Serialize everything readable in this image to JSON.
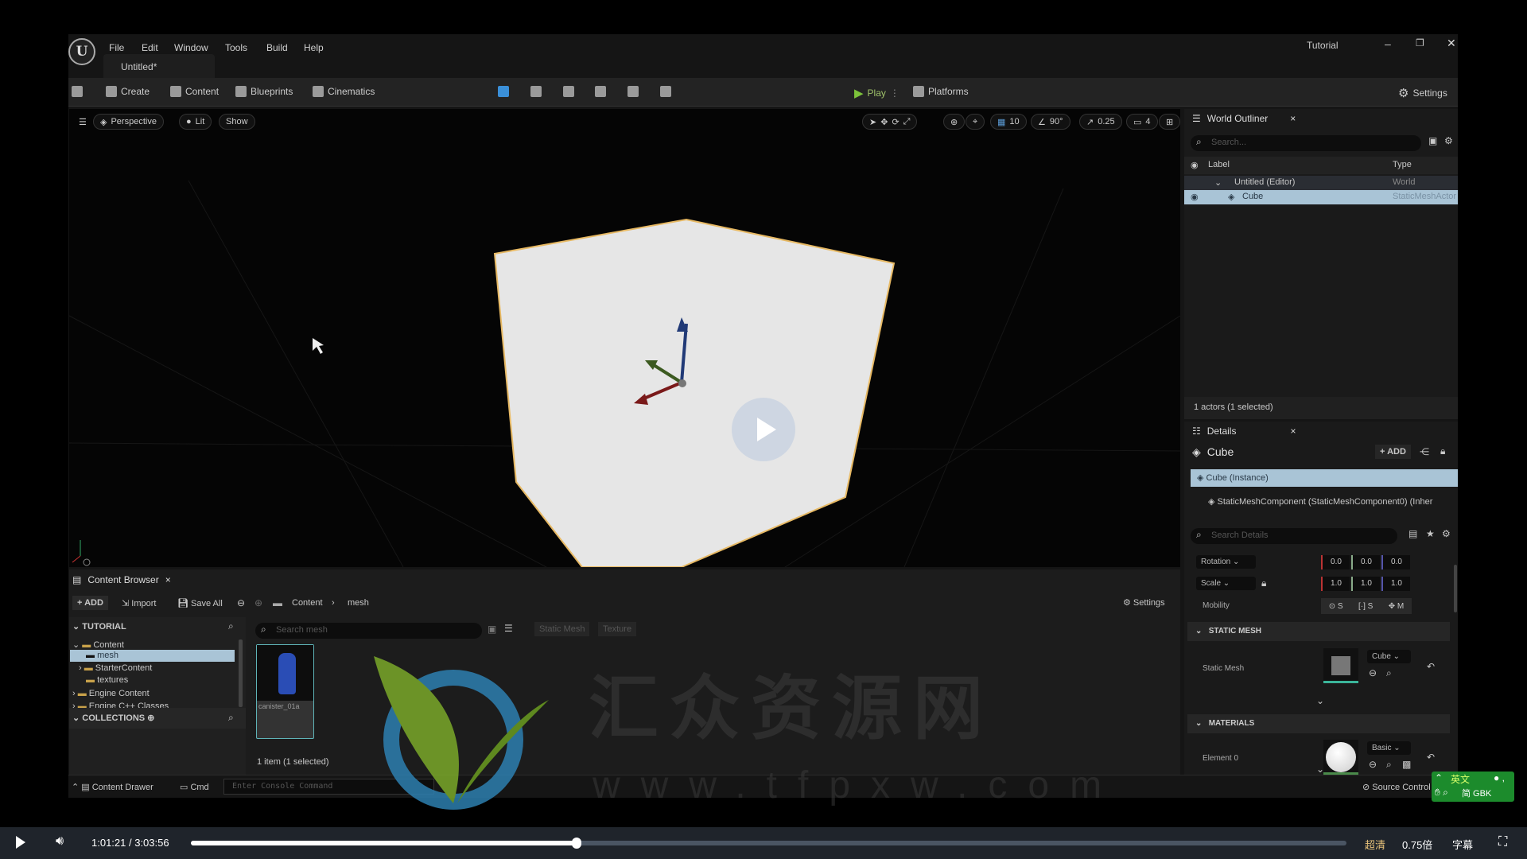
{
  "menu": {
    "items": [
      "File",
      "Edit",
      "Window",
      "Tools",
      "Build",
      "Help"
    ],
    "project": "Tutorial",
    "doc_tab": "Untitled*"
  },
  "toolbar": {
    "create": "Create",
    "content": "Content",
    "blueprints": "Blueprints",
    "cinematics": "Cinematics",
    "play": "Play",
    "platforms": "Platforms",
    "settings": "Settings"
  },
  "viewport": {
    "perspective": "Perspective",
    "lit": "Lit",
    "show": "Show",
    "grid": "10",
    "angle": "90°",
    "scale": "0.25",
    "camera_speed": "4"
  },
  "outliner": {
    "title": "World Outliner",
    "search_placeholder": "Search...",
    "col_label": "Label",
    "col_type": "Type",
    "rows": [
      {
        "label": "Untitled (Editor)",
        "type": "World"
      },
      {
        "label": "Cube",
        "type": "StaticMeshActor"
      }
    ],
    "status": "1 actors (1 selected)"
  },
  "details": {
    "title": "Details",
    "actor": "Cube",
    "add": "ADD",
    "instance": "Cube (Instance)",
    "component": "StaticMeshComponent (StaticMeshComponent0) (Inher",
    "search_placeholder": "Search Details",
    "rotation_label": "Rotation",
    "rotation": [
      "0.0",
      "0.0",
      "0.0"
    ],
    "scale_label": "Scale",
    "scale": [
      "1.0",
      "1.0",
      "1.0"
    ],
    "mobility_label": "Mobility",
    "mobility": [
      "S",
      "S",
      "M"
    ],
    "static_mesh_section": "STATIC MESH",
    "static_mesh_label": "Static Mesh",
    "static_mesh_value": "Cube",
    "materials_section": "MATERIALS",
    "element_label": "Element 0",
    "element_value": "Basic"
  },
  "content_browser": {
    "title": "Content Browser",
    "add": "ADD",
    "import": "Import",
    "save_all": "Save All",
    "path": [
      "Content",
      "mesh"
    ],
    "settings": "Settings",
    "tutorial": "TUTORIAL",
    "tree": [
      {
        "label": "Content",
        "level": 0
      },
      {
        "label": "mesh",
        "level": 1
      },
      {
        "label": "StarterContent",
        "level": 1
      },
      {
        "label": "textures",
        "level": 1
      },
      {
        "label": "Engine Content",
        "level": 0
      },
      {
        "label": "Engine C++ Classes",
        "level": 0
      }
    ],
    "collections": "COLLECTIONS",
    "search_placeholder": "Search mesh",
    "filters": [
      "Static Mesh",
      "Texture"
    ],
    "asset": "canister_01a",
    "status": "1 item (1 selected)"
  },
  "statusbar": {
    "content_drawer": "Content Drawer",
    "cmd": "Cmd",
    "console_placeholder": "Enter Console Command",
    "source_control": "Source Control"
  },
  "ime": {
    "mode": "英文",
    "sub": "简 GBK"
  },
  "watermark": {
    "name": "汇众资源网",
    "url": "www.tfpxw.com"
  },
  "player": {
    "current": "1:01:21",
    "total": "3:03:56",
    "progress": 0.3335,
    "quality": "超清",
    "speed": "0.75倍",
    "subtitle": "字幕"
  },
  "colors": {
    "selection": "#a9c4d6",
    "play": "#7cc23a",
    "progress": "#ffffff",
    "quality": "#e8c27a"
  }
}
